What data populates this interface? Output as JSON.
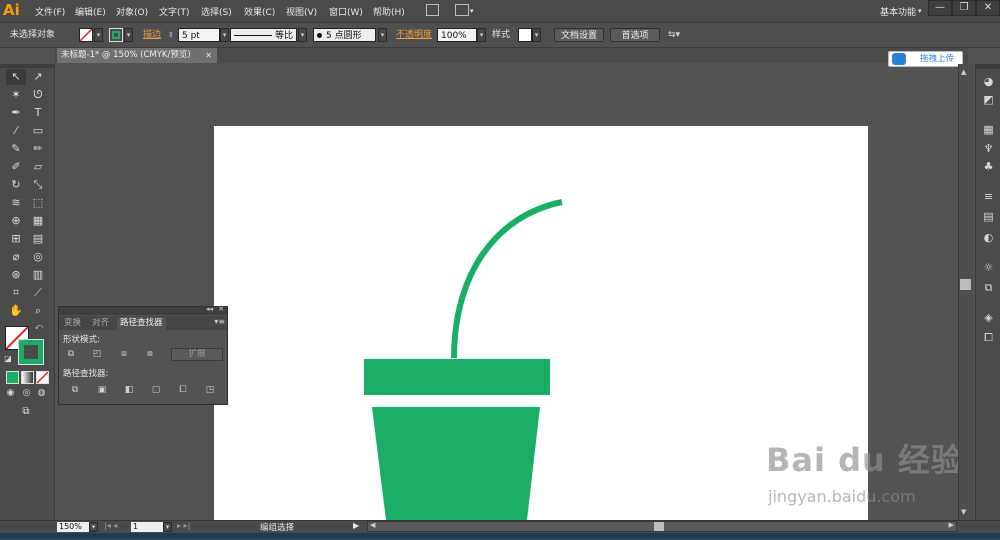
{
  "app": {
    "logo": "Ai",
    "workspace": "基本功能"
  },
  "menubar": {
    "items": [
      "文件(F)",
      "编辑(E)",
      "对象(O)",
      "文字(T)",
      "选择(S)",
      "效果(C)",
      "视图(V)",
      "窗口(W)",
      "帮助(H)"
    ],
    "icons": [
      "bridge-icon",
      "arrange-documents-icon"
    ]
  },
  "window_controls": {
    "minimize": "—",
    "restore": "❐",
    "close": "✕"
  },
  "controlbar": {
    "selection_status": "未选择对象",
    "stroke_label": "描边",
    "stroke_weight": "5 pt",
    "profile_label": "等比",
    "brush_label": "5 点圆形",
    "opacity_label": "不透明度",
    "opacity_value": "100%",
    "style_label": "样式",
    "doc_setup": "文档设置",
    "preferences": "首选项"
  },
  "document": {
    "tab_title": "未标题-1* @ 150% (CMYK/预览)",
    "close": "✕"
  },
  "upload": {
    "label": "拖拽上传"
  },
  "artwork": {
    "fill_color": "#1aad66",
    "stroke_color": "#1aad66"
  },
  "pathfinder_panel": {
    "tabs": [
      "变换",
      "对齐",
      "路径查找器"
    ],
    "active_tab": "路径查找器",
    "shape_modes_label": "形状模式:",
    "expand_button": "扩展",
    "pathfinders_label": "路径查找器:"
  },
  "statusbar": {
    "zoom": "150%",
    "page": "1",
    "tool_status": "编组选择"
  },
  "watermark": {
    "text": "Bai du 经验",
    "url": "jingyan.baidu.com"
  }
}
